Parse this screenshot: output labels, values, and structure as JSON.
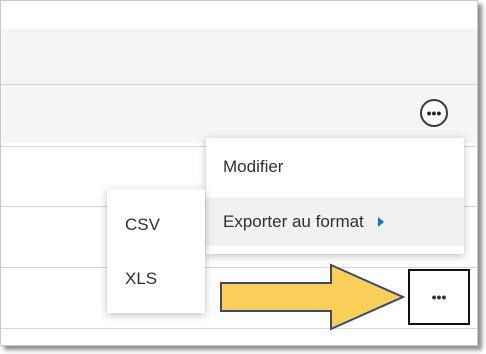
{
  "row_actions_button": {
    "glyph": "•••"
  },
  "context_menu": {
    "items": [
      {
        "label": "Modifier"
      },
      {
        "label": "Exporter au format",
        "has_submenu": true,
        "highlighted": true
      }
    ]
  },
  "export_submenu": {
    "items": [
      {
        "label": "CSV"
      },
      {
        "label": "XLS"
      }
    ]
  },
  "callout": {
    "arrow_color": "#f9cf5a",
    "arrow_outline_color": "#3a4a6b",
    "target_glyph": "•••"
  },
  "colors": {
    "submenu_indicator": "#1a73c8",
    "band": "#f5f5f5"
  }
}
